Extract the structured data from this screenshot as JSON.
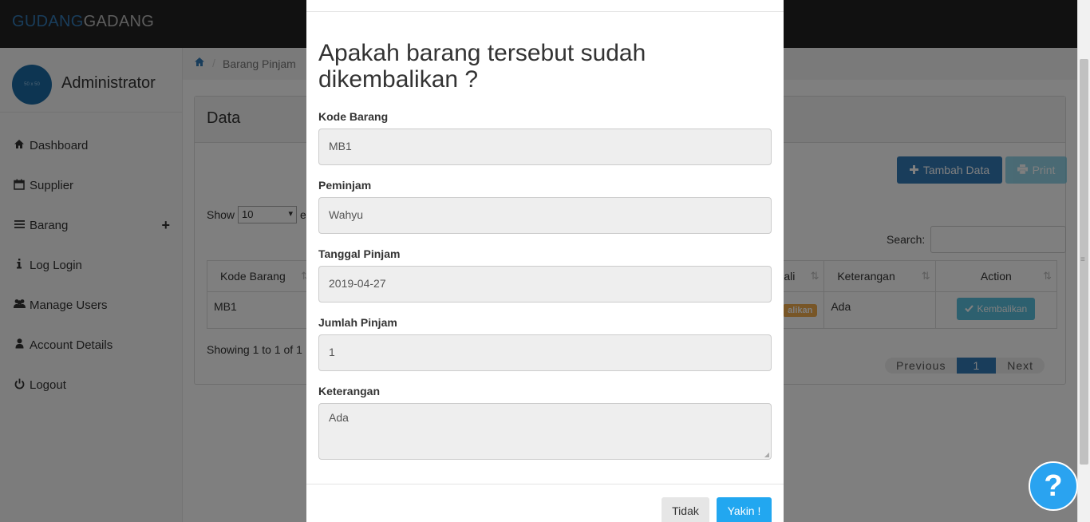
{
  "navbar": {
    "brand_part1": "GUDANG",
    "brand_part2": "GADANG"
  },
  "sidebar": {
    "avatar_text": "50 x 50",
    "user_name": "Administrator",
    "items": [
      {
        "label": "Dashboard",
        "icon": "home-icon"
      },
      {
        "label": "Supplier",
        "icon": "calendar-icon"
      },
      {
        "label": "Barang",
        "icon": "bars-icon",
        "expander": "+"
      },
      {
        "label": "Log Login",
        "icon": "info-icon"
      },
      {
        "label": "Manage Users",
        "icon": "users-icon"
      },
      {
        "label": "Account Details",
        "icon": "user-icon"
      },
      {
        "label": "Logout",
        "icon": "power-icon"
      }
    ]
  },
  "breadcrumb": {
    "item": "Barang Pinjam"
  },
  "panel": {
    "title": "Data",
    "add_button": "Tambah Data",
    "print_button": "Print",
    "show_label": "Show",
    "show_value": "10",
    "show_suffix": "e",
    "search_label": "Search:",
    "columns": [
      "Kode Barang",
      "mbali",
      "Keterangan",
      "Action"
    ],
    "row": {
      "kode": "MB1",
      "status_tag": "alikan",
      "keterangan": "Ada",
      "action_label": "Kembalikan"
    },
    "showing_text": "Showing 1 to 1 of 1",
    "pagination": {
      "previous": "Previous",
      "current": "1",
      "next": "Next"
    }
  },
  "modal": {
    "title": "Apakah barang tersebut sudah dikembalikan ?",
    "fields": [
      {
        "label": "Kode Barang",
        "value": "MB1"
      },
      {
        "label": "Peminjam",
        "value": "Wahyu"
      },
      {
        "label": "Tanggal Pinjam",
        "value": "2019-04-27"
      },
      {
        "label": "Jumlah Pinjam",
        "value": "1"
      },
      {
        "label": "Keterangan",
        "value": "Ada"
      }
    ],
    "cancel_button": "Tidak",
    "confirm_button": "Yakin !"
  },
  "help_button": "?"
}
